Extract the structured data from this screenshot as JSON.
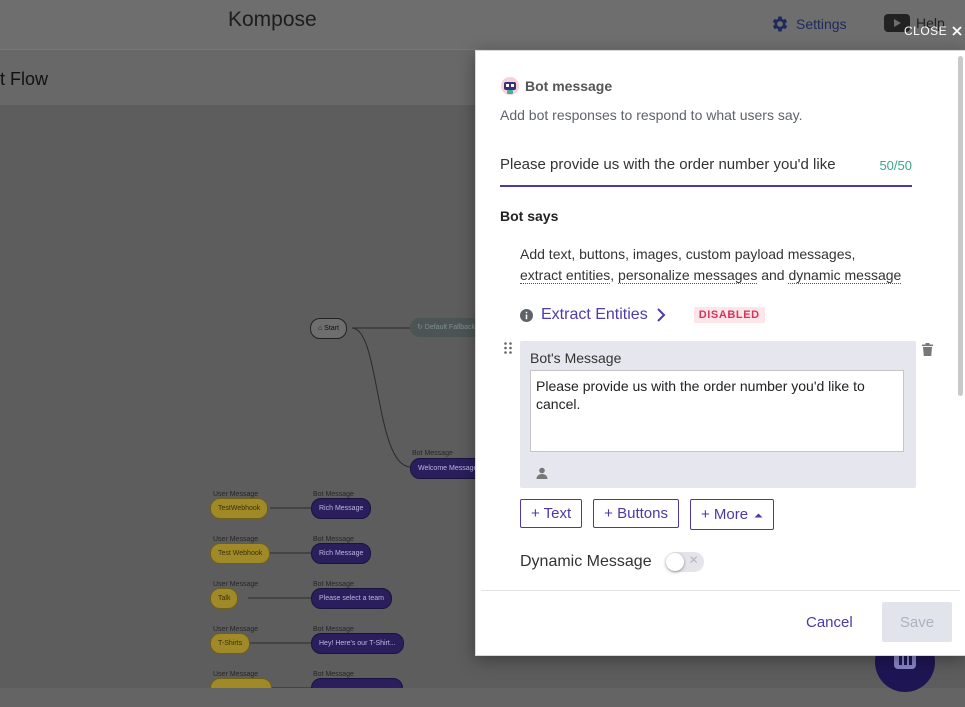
{
  "app": {
    "title": "Kompose",
    "settings_label": "Settings",
    "help_label": "Help",
    "flow_title": "t Flow"
  },
  "canvas": {
    "nodes": [
      {
        "label_above": "",
        "text": "⌂ Start",
        "kind": "start"
      },
      {
        "label_above": "",
        "text": "↻ Default Fallback",
        "kind": "fallback"
      },
      {
        "label_above": "Bot Message",
        "text": "Welcome Message",
        "kind": "bot"
      },
      {
        "label_above": "User Message",
        "text": "TestWebhook",
        "kind": "user"
      },
      {
        "label_above": "Bot Message",
        "text": "Rich Message",
        "kind": "bot"
      },
      {
        "label_above": "User Message",
        "text": "Test Webhook",
        "kind": "user"
      },
      {
        "label_above": "Bot Message",
        "text": "Rich Message",
        "kind": "bot"
      },
      {
        "label_above": "User Message",
        "text": "Talk",
        "kind": "user"
      },
      {
        "label_above": "Bot Message",
        "text": "Please select a team",
        "kind": "bot"
      },
      {
        "label_above": "User Message",
        "text": "T-Shirts",
        "kind": "user"
      },
      {
        "label_above": "Bot Message",
        "text": "Hey! Here's our T-Shirt...",
        "kind": "bot"
      },
      {
        "label_above": "User Message",
        "text": "",
        "kind": "user"
      },
      {
        "label_above": "Bot Message",
        "text": "",
        "kind": "bot"
      }
    ]
  },
  "modal": {
    "close_label": "CLOSE",
    "title": "Bot message",
    "subtitle": "Add bot responses to respond to what users say.",
    "name_value": "Please provide us with the order number you'd like",
    "name_counter": "50/50",
    "section_title": "Bot says",
    "help": {
      "prefix": "Add text, buttons, images, custom payload messages,",
      "link1": "extract entities",
      "sep1": ", ",
      "link2": "personalize messages",
      "sep2": " and ",
      "link3": "dynamic message"
    },
    "extract_label": "Extract Entities",
    "extract_status": "DISABLED",
    "card_title": "Bot's Message",
    "message_text": "Please provide us with the order number you'd like to cancel.",
    "buttons": {
      "text": "+ Text",
      "buttons": "+ Buttons",
      "more": "+ More"
    },
    "dynamic_label": "Dynamic Message",
    "dynamic_enabled": false,
    "cancel_label": "Cancel",
    "save_label": "Save"
  },
  "colors": {
    "accent": "#4a3aa6",
    "counter": "#3aa58b",
    "badge_text": "#d1365c",
    "badge_bg": "#fde6ea"
  }
}
